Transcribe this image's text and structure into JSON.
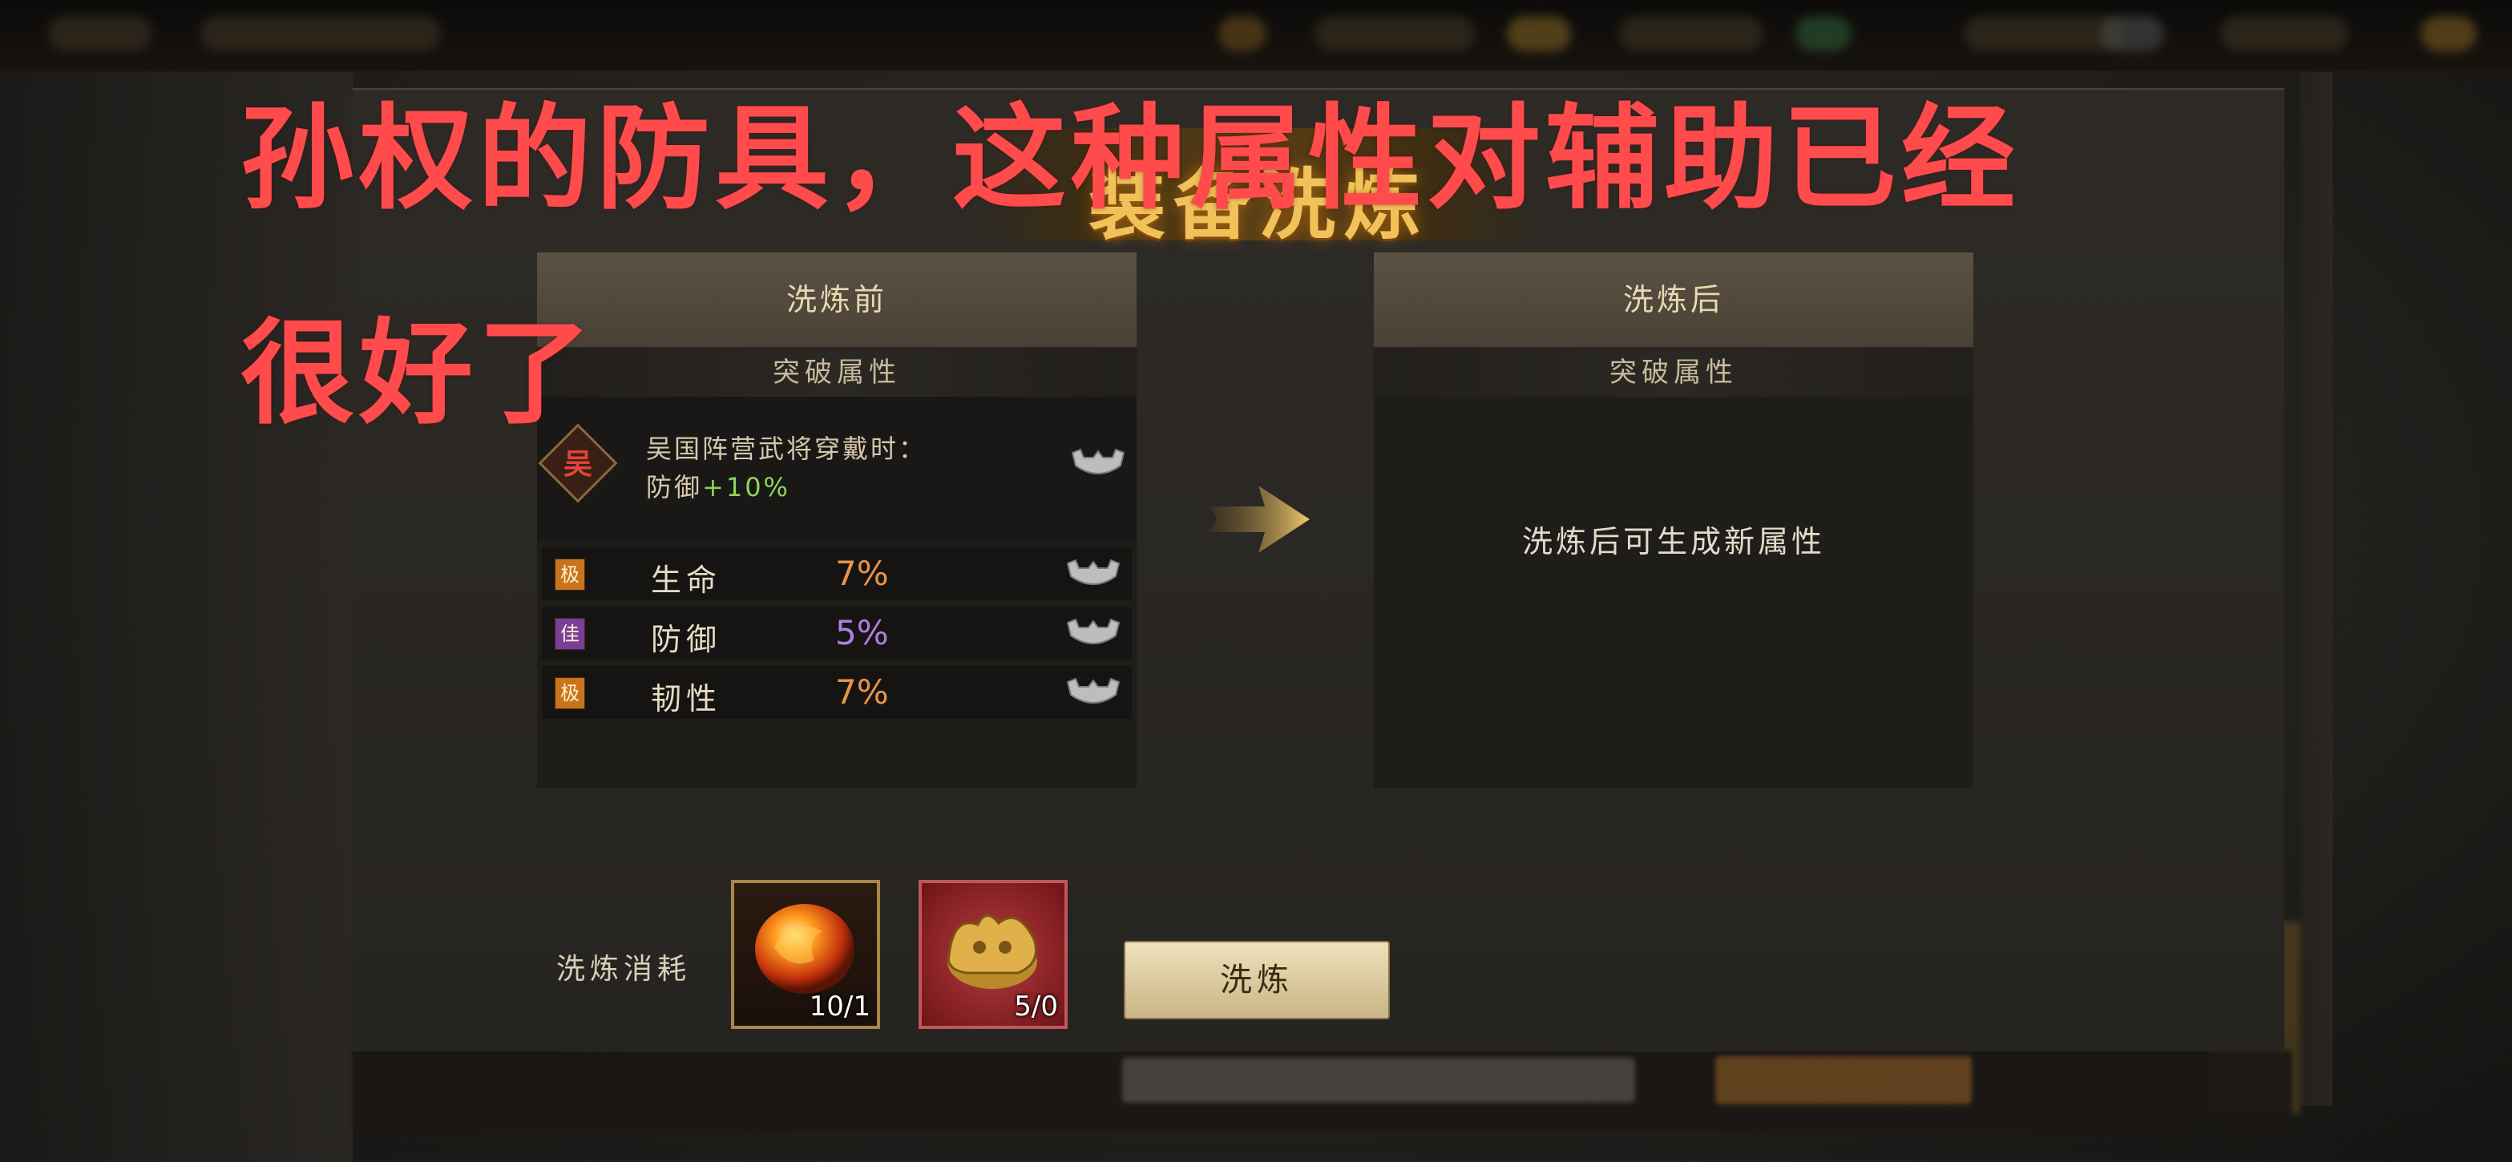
{
  "dialog": {
    "title": "装备洗炼"
  },
  "before_panel": {
    "header": "洗炼前",
    "section": "突破属性",
    "bonus": {
      "badge": "吴",
      "line1": "吴国阵营武将穿戴时：",
      "line2_prefix": "防御",
      "line2_value": "+10%"
    },
    "attributes": [
      {
        "grade": "极",
        "grade_color": "#c8741a",
        "name": "生命",
        "value": "7%",
        "value_color": "#e8944a"
      },
      {
        "grade": "佳",
        "grade_color": "#7c3c9a",
        "name": "防御",
        "value": "5%",
        "value_color": "#b07de0"
      },
      {
        "grade": "极",
        "grade_color": "#c8741a",
        "name": "韧性",
        "value": "7%",
        "value_color": "#e8944a"
      }
    ]
  },
  "after_panel": {
    "header": "洗炼后",
    "section": "突破属性",
    "placeholder": "洗炼后可生成新属性"
  },
  "cost": {
    "label": "洗炼消耗",
    "items": [
      {
        "icon": "fire-stone-icon",
        "count": "10/1"
      },
      {
        "icon": "gold-ornament-icon",
        "count": "5/0"
      }
    ]
  },
  "wash_button": "洗炼",
  "overlay_caption": {
    "line1": "孙权的防具，这种属性对辅助已经",
    "line2": "很好了"
  },
  "colors": {
    "caption": "#ff4b4b",
    "title": "#f1c25a",
    "positive": "#8fd35a"
  }
}
